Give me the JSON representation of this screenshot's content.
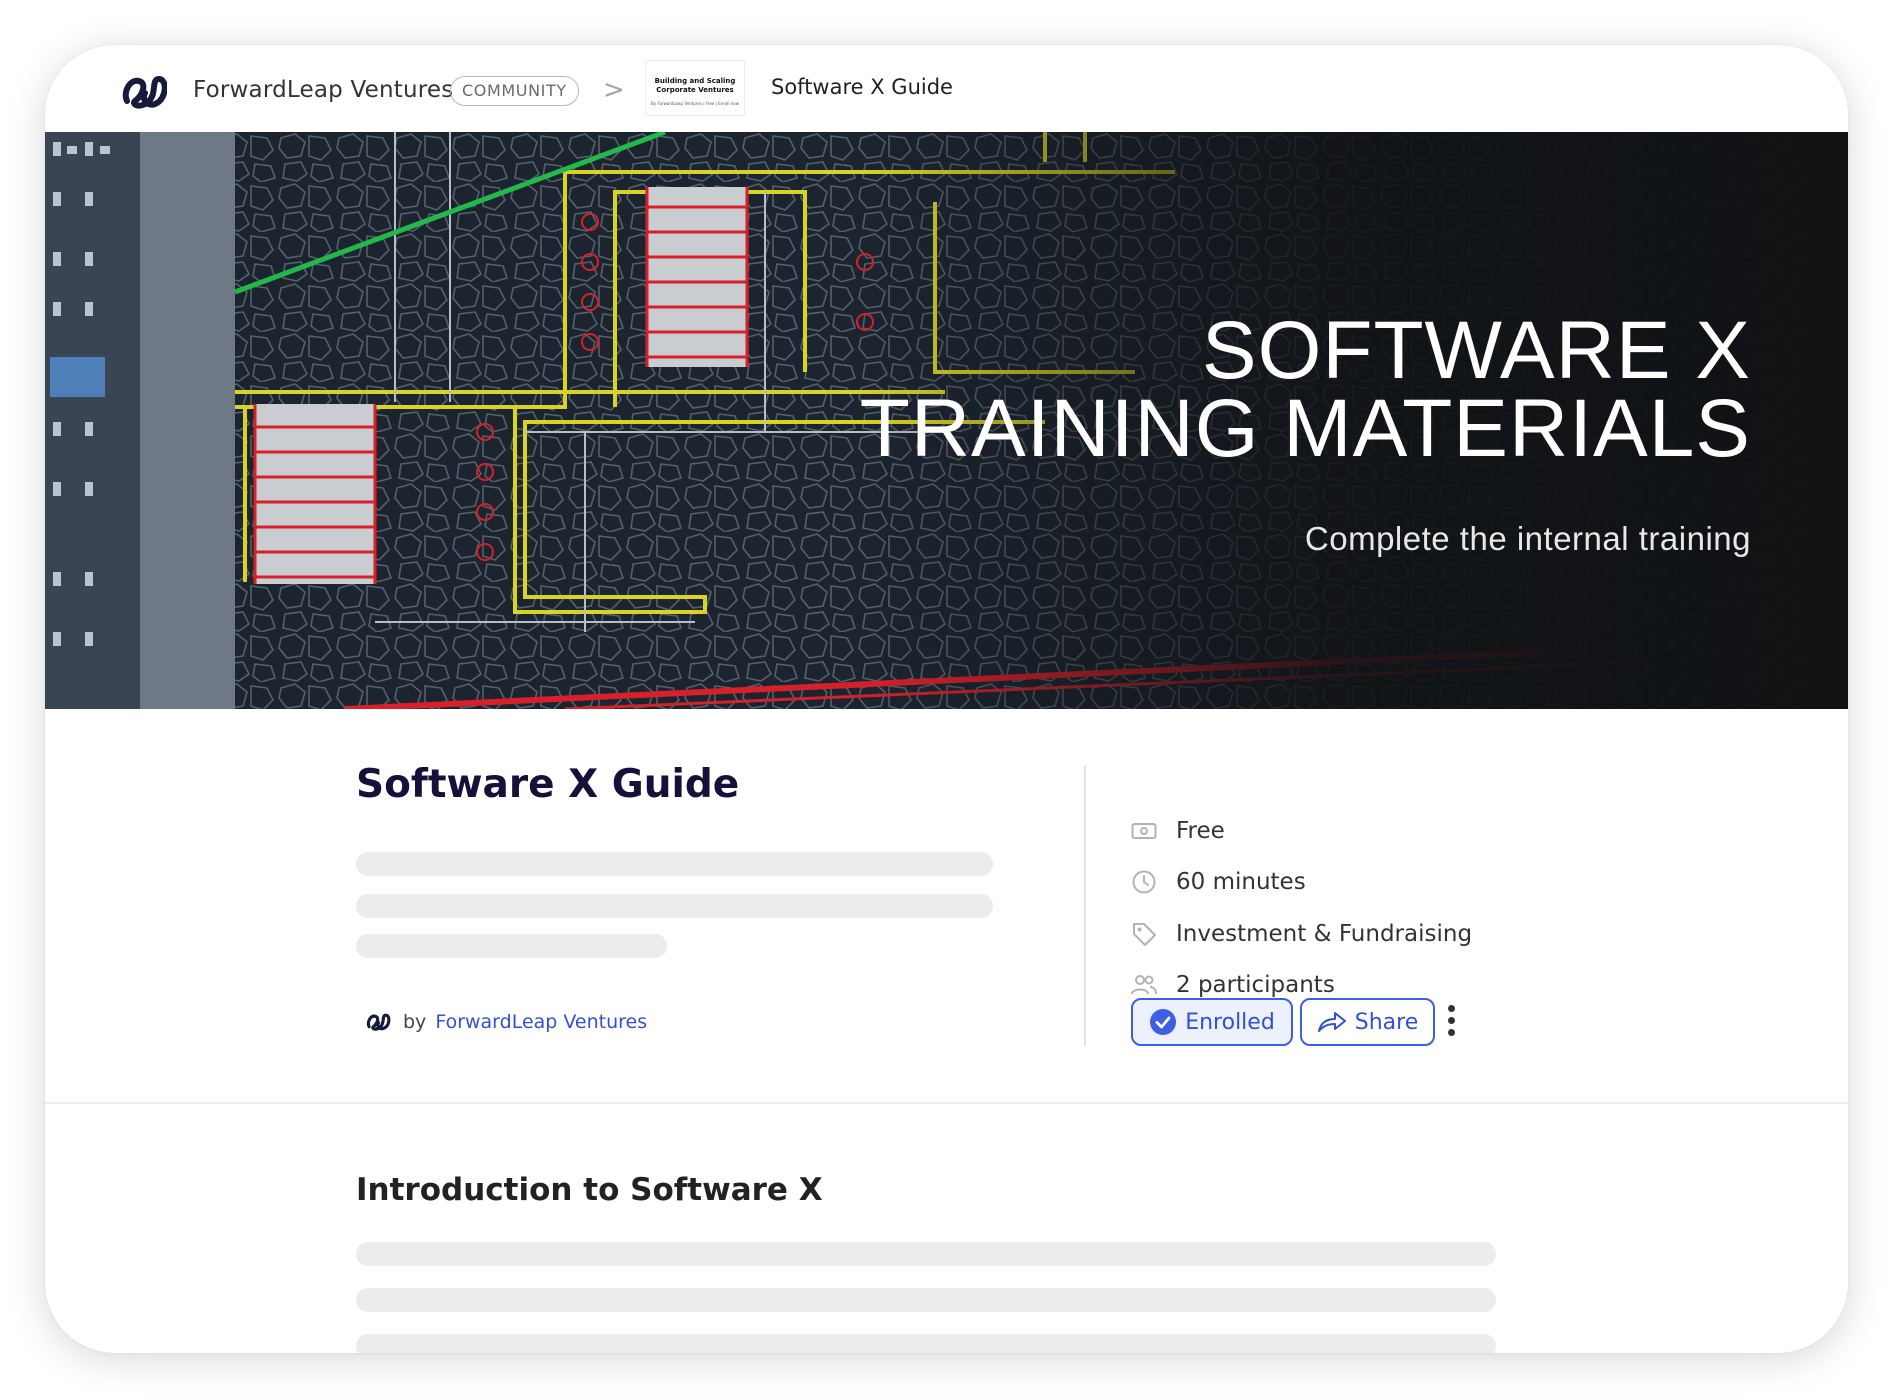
{
  "header": {
    "brand": "ForwardLeap Ventures",
    "badge": "COMMUNITY",
    "separator": ">",
    "thumbnail": {
      "title": "Building and Scaling Corporate Ventures",
      "caption": "By ForwardLeap Ventures | Free | Enroll now"
    },
    "current": "Software X Guide"
  },
  "hero": {
    "title_line1": "SOFTWARE X",
    "title_line2": "TRAINING MATERIALS",
    "subtitle": "Complete the internal training"
  },
  "course": {
    "title": "Software X Guide",
    "by_label": "by",
    "organization": "ForwardLeap Ventures"
  },
  "meta": {
    "price": "Free",
    "duration": "60 minutes",
    "category": "Investment & Fundraising",
    "participants": "2 participants"
  },
  "actions": {
    "enrolled": "Enrolled",
    "share": "Share"
  },
  "section": {
    "title": "Introduction to Software X"
  },
  "colors": {
    "accent": "#3e5fe3",
    "link": "#3250d6",
    "title": "#14113a",
    "hero_bg": "#101214"
  },
  "icons": {
    "price": "cash-icon",
    "duration": "clock-icon",
    "category": "tag-icon",
    "participants": "people-icon",
    "enrolled": "check-circle-icon",
    "share": "share-arrow-icon",
    "more": "kebab-menu-icon"
  }
}
